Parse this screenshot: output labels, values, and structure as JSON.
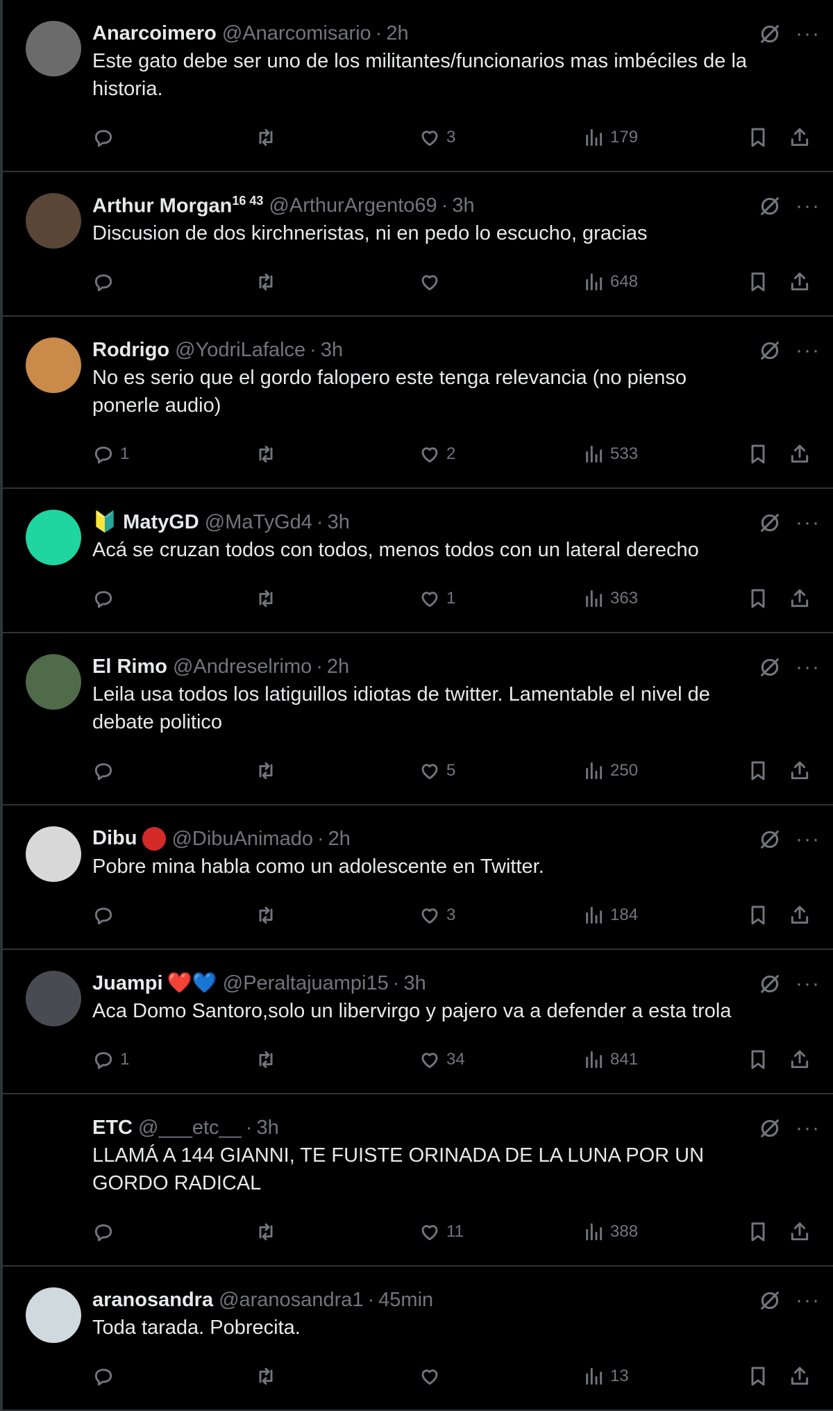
{
  "tweets": [
    {
      "name": "Anarcoimero",
      "name_sup": "",
      "handle": "@Anarcomisario",
      "time": "2h",
      "text": "Este gato debe ser uno de los militantes/funcionarios mas imbéciles de la historia.",
      "replies": "",
      "retweets": "",
      "likes": "3",
      "views": "179",
      "avatar_color": "#6b6b6b"
    },
    {
      "name": "Arthur Morgan",
      "name_sup": "16 43",
      "handle": "@ArthurArgento69",
      "time": "3h",
      "text": "Discusion de dos kirchneristas, ni en pedo lo escucho, gracias",
      "replies": "",
      "retweets": "",
      "likes": "",
      "views": "648",
      "avatar_color": "#5a4636"
    },
    {
      "name": "Rodrigo",
      "name_sup": "",
      "handle": "@YodriLafalce",
      "time": "3h",
      "text": "No es serio que el gordo falopero este tenga relevancia (no pienso ponerle audio)",
      "replies": "1",
      "retweets": "",
      "likes": "2",
      "views": "533",
      "avatar_color": "#c98a4a"
    },
    {
      "name": "MatyGD",
      "name_sup": "",
      "handle": "@MaTyGd4",
      "time": "3h",
      "text": "Acá se cruzan todos con todos, menos todos con un lateral derecho",
      "replies": "",
      "retweets": "",
      "likes": "1",
      "views": "363",
      "avatar_color": "#1fd6a0",
      "badge": "🔰"
    },
    {
      "name": "El Rimo",
      "name_sup": "",
      "handle": "@Andreselrimo",
      "time": "2h",
      "text": "Leila usa todos los latiguillos idiotas de twitter. Lamentable el nivel de debate politico",
      "replies": "",
      "retweets": "",
      "likes": "5",
      "views": "250",
      "avatar_color": "#4f6b4a"
    },
    {
      "name": "Dibu",
      "name_sup": "",
      "handle": "@DibuAnimado",
      "time": "2h",
      "text": "Pobre mina habla como un adolescente en Twitter.",
      "replies": "",
      "retweets": "",
      "likes": "3",
      "views": "184",
      "avatar_color": "#d8d8d8",
      "emoji_color": "#d42a2a"
    },
    {
      "name": "Juampi",
      "name_sup": "",
      "handle": "@Peraltajuampi15",
      "time": "3h",
      "text": "Aca Domo Santoro,solo un libervirgo y pajero va a defender a esta trola",
      "replies": "1",
      "retweets": "",
      "likes": "34",
      "views": "841",
      "avatar_color": "#4a4a52",
      "hearts": "❤️💙"
    },
    {
      "name": "ETC",
      "name_sup": "",
      "handle": "@___etc__",
      "time": "3h",
      "text": "LLAMÁ A 144 GIANNI, TE FUISTE ORINADA DE LA LUNA POR UN GORDO RADICAL",
      "replies": "",
      "retweets": "",
      "likes": "11",
      "views": "388",
      "avatar_color": "#000000"
    },
    {
      "name": "aranosandra",
      "name_sup": "",
      "handle": "@aranosandra1",
      "time": "45min",
      "text": "Toda tarada. Pobrecita.",
      "replies": "",
      "retweets": "",
      "likes": "",
      "views": "13",
      "avatar_color": "#cfd9de"
    }
  ],
  "icons": {
    "reply": "reply-icon",
    "retweet": "retweet-icon",
    "like": "heart-icon",
    "views": "views-icon",
    "bookmark": "bookmark-icon",
    "share": "share-icon",
    "grok": "grok-icon",
    "more": "more-icon"
  },
  "more_glyph": "···"
}
